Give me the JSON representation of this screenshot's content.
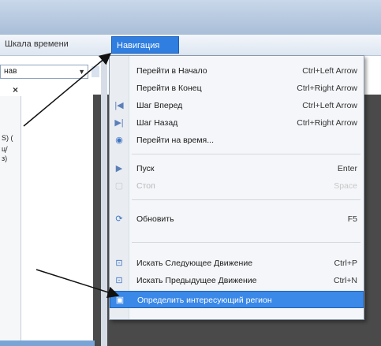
{
  "menubar": {
    "timeline_label": "Шкала времени",
    "navigation_label": "Навигация"
  },
  "toolbar": {
    "combo_value": "нав",
    "close_symbol": "×"
  },
  "side_panel": {
    "lines": [
      "S) (",
      "ц/",
      "з)"
    ]
  },
  "dropdown": {
    "items": [
      {
        "label": "Перейти в Начало",
        "shortcut": "Ctrl+Left Arrow",
        "icon": "",
        "enabled": true
      },
      {
        "label": "Перейти в Конец",
        "shortcut": "Ctrl+Right Arrow",
        "icon": "",
        "enabled": true
      },
      {
        "label": "Шаг Вперед",
        "shortcut": "Ctrl+Left Arrow",
        "icon": "step-forward-icon",
        "enabled": true
      },
      {
        "label": "Шаг Назад",
        "shortcut": "Ctrl+Right Arrow",
        "icon": "step-back-icon",
        "enabled": true
      },
      {
        "label": "Перейти на время...",
        "shortcut": "",
        "icon": "goto-time-icon",
        "enabled": true
      },
      {
        "label": "Пуск",
        "shortcut": "Enter",
        "icon": "play-icon",
        "enabled": true
      },
      {
        "label": "Стоп",
        "shortcut": "Space",
        "icon": "stop-icon",
        "enabled": false
      },
      {
        "label": "Обновить",
        "shortcut": "F5",
        "icon": "refresh-icon",
        "enabled": true
      },
      {
        "label": "Искать Следующее Движение",
        "shortcut": "Ctrl+P",
        "icon": "find-next-icon",
        "enabled": true
      },
      {
        "label": "Искать Предыдущее Движение",
        "shortcut": "Ctrl+N",
        "icon": "find-prev-icon",
        "enabled": true
      },
      {
        "label": "Определить интересующий регион",
        "shortcut": "",
        "icon": "region-icon",
        "enabled": true
      }
    ]
  },
  "colors": {
    "highlight": "#3a88e8",
    "menu_active": "#2f7ee0"
  }
}
